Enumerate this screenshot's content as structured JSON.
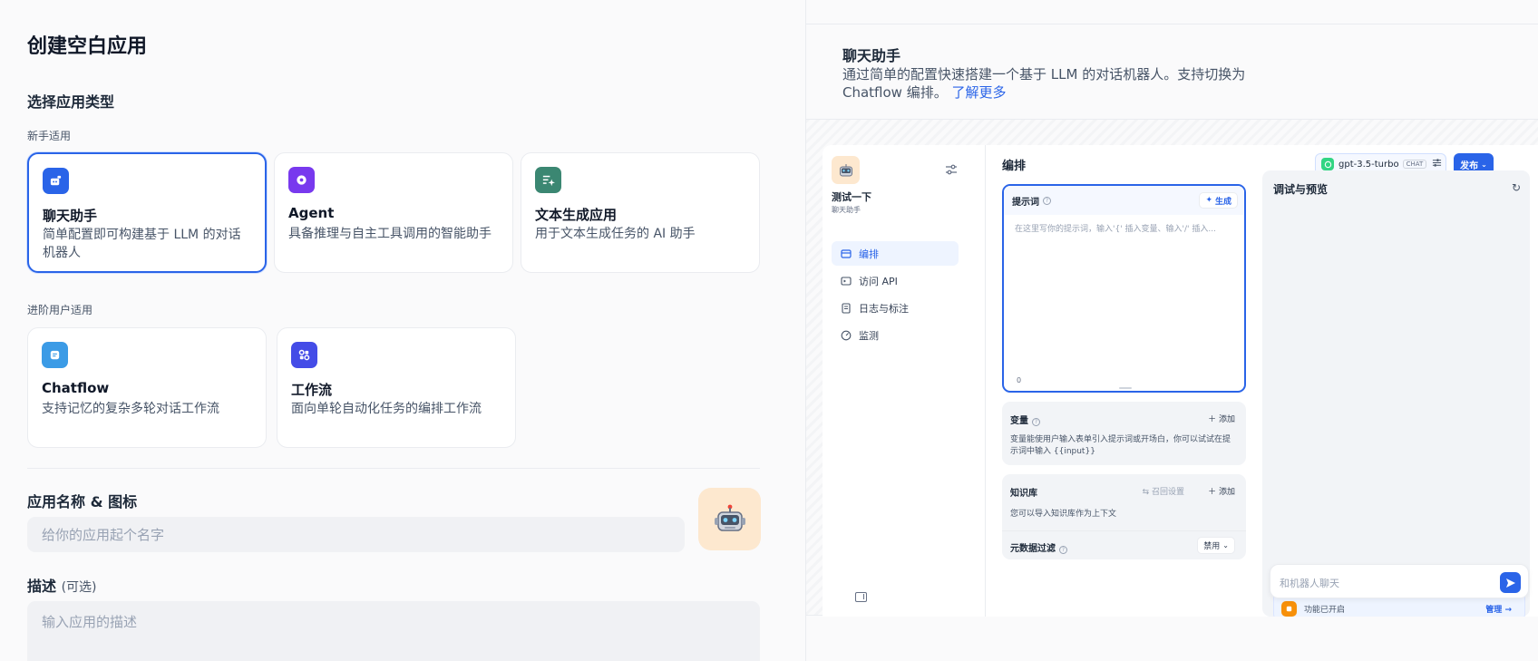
{
  "left": {
    "title": "创建空白应用",
    "section_title": "选择应用类型",
    "beginner_label": "新手适用",
    "advanced_label": "进阶用户适用",
    "cards": [
      {
        "title": "聊天助手",
        "desc": "简单配置即可构建基于 LLM 的对话机器人",
        "icon": "chat-bot-icon",
        "color": "#2a64e8",
        "selected": true
      },
      {
        "title": "Agent",
        "desc": "具备推理与自主工具调用的智能助手",
        "icon": "agent-icon",
        "color": "#7839ee",
        "selected": false
      },
      {
        "title": "文本生成应用",
        "desc": "用于文本生成任务的 AI 助手",
        "icon": "text-gen-icon",
        "color": "#3b8772",
        "selected": false
      },
      {
        "title": "Chatflow",
        "desc": "支持记忆的复杂多轮对话工作流",
        "icon": "chatflow-icon",
        "color": "#3b9be6",
        "selected": false
      },
      {
        "title": "工作流",
        "desc": "面向单轮自动化任务的编排工作流",
        "icon": "workflow-icon",
        "color": "#444ce7",
        "selected": false
      }
    ],
    "name_label": "应用名称 & 图标",
    "name_placeholder": "给你的应用起个名字",
    "desc_label": "描述",
    "desc_optional": "(可选)",
    "desc_placeholder": "输入应用的描述"
  },
  "right": {
    "title": "聊天助手",
    "desc": "通过简单的配置快速搭建一个基于 LLM 的对话机器人。支持切换为 Chatflow 编排。",
    "learn_more": "了解更多",
    "mock": {
      "app_name": "测试一下",
      "app_type": "聊天助手",
      "nav": [
        "编排",
        "访问 API",
        "日志与标注",
        "监测"
      ],
      "heading": "编排",
      "model": "gpt-3.5-turbo",
      "model_tag": "CHAT",
      "publish": "发布",
      "prompt_title": "提示词",
      "generate": "生成",
      "prompt_placeholder": "在这里写你的提示词，输入'{' 插入变量、输入'/' 插入...",
      "prompt_count": "0",
      "var_title": "变量",
      "add": "添加",
      "var_desc": "变量能使用户输入表单引入提示词或开场白，你可以试试在提示词中输入 {{input}}",
      "kb_title": "知识库",
      "recall": "召回设置",
      "kb_desc": "您可以导入知识库作为上下文",
      "meta_title": "元数据过滤",
      "meta_value": "禁用",
      "preview_title": "调试与预览",
      "chat_placeholder": "和机器人聊天",
      "feature_text": "功能已开启",
      "manage": "管理"
    }
  },
  "colors": {
    "accent": "#2a64e8",
    "avatar_bg": "#fde8cf"
  }
}
